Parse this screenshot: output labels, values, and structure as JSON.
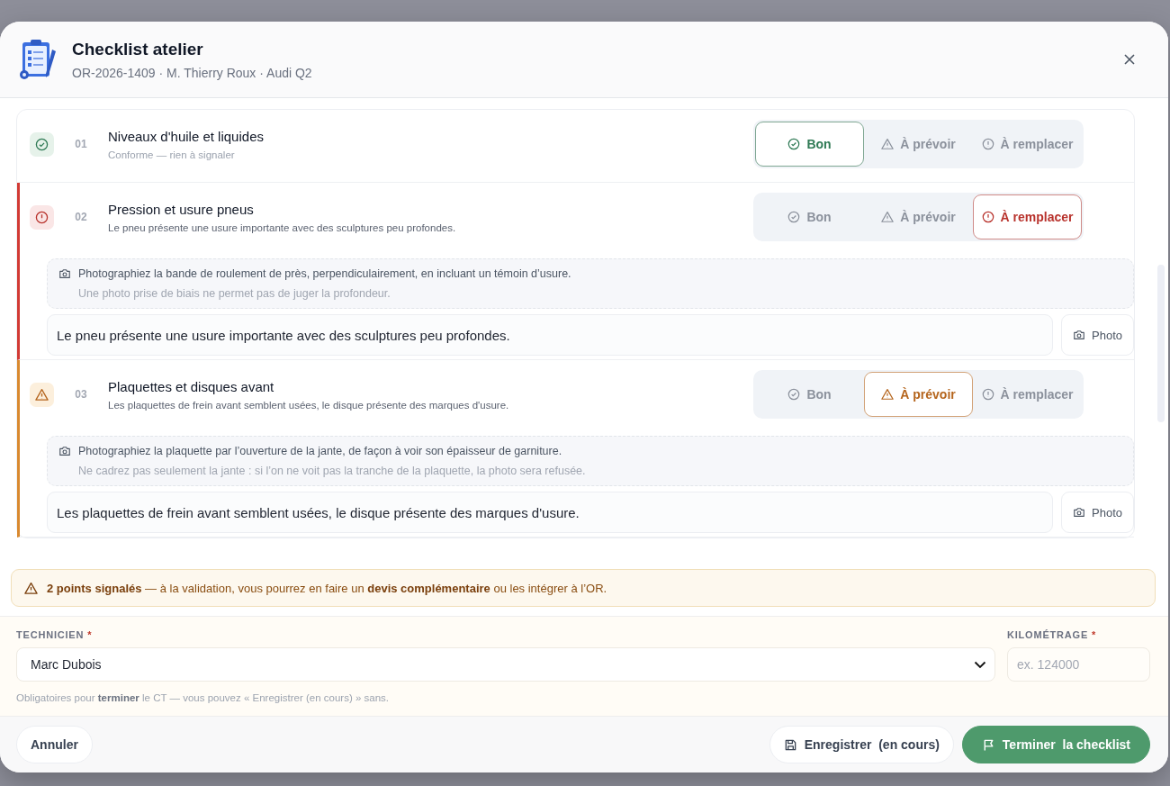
{
  "header": {
    "title": "Checklist atelier",
    "subtitle": "OR-2026-1409 · M. Thierry Roux · Audi Q2"
  },
  "items": [
    {
      "number": "01",
      "title": "Niveaux d'huile et liquides",
      "summary": "Conforme — rien à signaler",
      "kind": "ok",
      "options": [
        {
          "kind": "ok",
          "label": "Bon",
          "selected": true
        },
        {
          "kind": "plan",
          "label": "À prévoir",
          "selected": false
        },
        {
          "kind": "replace",
          "label": "À remplacer",
          "selected": false
        }
      ]
    },
    {
      "number": "02",
      "title": "Pression et usure pneus",
      "summary": "Le pneu présente une usure importante avec des sculptures peu profondes.",
      "kind": "replace",
      "options": [
        {
          "kind": "ok",
          "label": "Bon",
          "selected": false
        },
        {
          "kind": "plan",
          "label": "À prévoir",
          "selected": false
        },
        {
          "kind": "replace",
          "label": "À remplacer",
          "selected": true
        }
      ],
      "hint": {
        "text": "Photographiez la bande de roulement de près, perpendiculairement, en incluant un témoin d’usure.",
        "subtext": "Une photo prise de biais ne permet pas de juger la profondeur."
      },
      "note": "Le pneu présente une usure importante avec des sculptures peu profondes.",
      "photo_button": "Photo"
    },
    {
      "number": "03",
      "title": "Plaquettes et disques avant",
      "summary": "Les plaquettes de frein avant semblent usées, le disque présente des marques d'usure.",
      "kind": "plan",
      "options": [
        {
          "kind": "ok",
          "label": "Bon",
          "selected": false
        },
        {
          "kind": "plan",
          "label": "À prévoir",
          "selected": true
        },
        {
          "kind": "replace",
          "label": "À remplacer",
          "selected": false
        }
      ],
      "hint": {
        "text": "Photographiez la plaquette par l’ouverture de la jante, de façon à voir son épaisseur de garniture.",
        "subtext": "Ne cadrez pas seulement la jante : si l’on ne voit pas la tranche de la plaquette, la photo sera refusée."
      },
      "note": "Les plaquettes de frein avant semblent usées, le disque présente des marques d'usure.",
      "photo_button": "Photo"
    }
  ],
  "alert": {
    "text": "**2 points signalés** — à la validation, vous pourrez en faire un **devis complémentaire** ou les intégrer à l’OR."
  },
  "form": {
    "technician": {
      "label": "TECHNICIEN",
      "required_mark": "*",
      "value": "Marc Dubois"
    },
    "mileage": {
      "label": "KILOMÉTRAGE",
      "required_mark": "*",
      "placeholder": "ex. 124000"
    },
    "help": "Obligatoires pour **terminer** le CT — vous pouvez « Enregistrer (en cours) » sans."
  },
  "actions": {
    "cancel": "Annuler",
    "save": "Enregistrer  (en cours)",
    "finish": "Terminer  la checklist"
  }
}
